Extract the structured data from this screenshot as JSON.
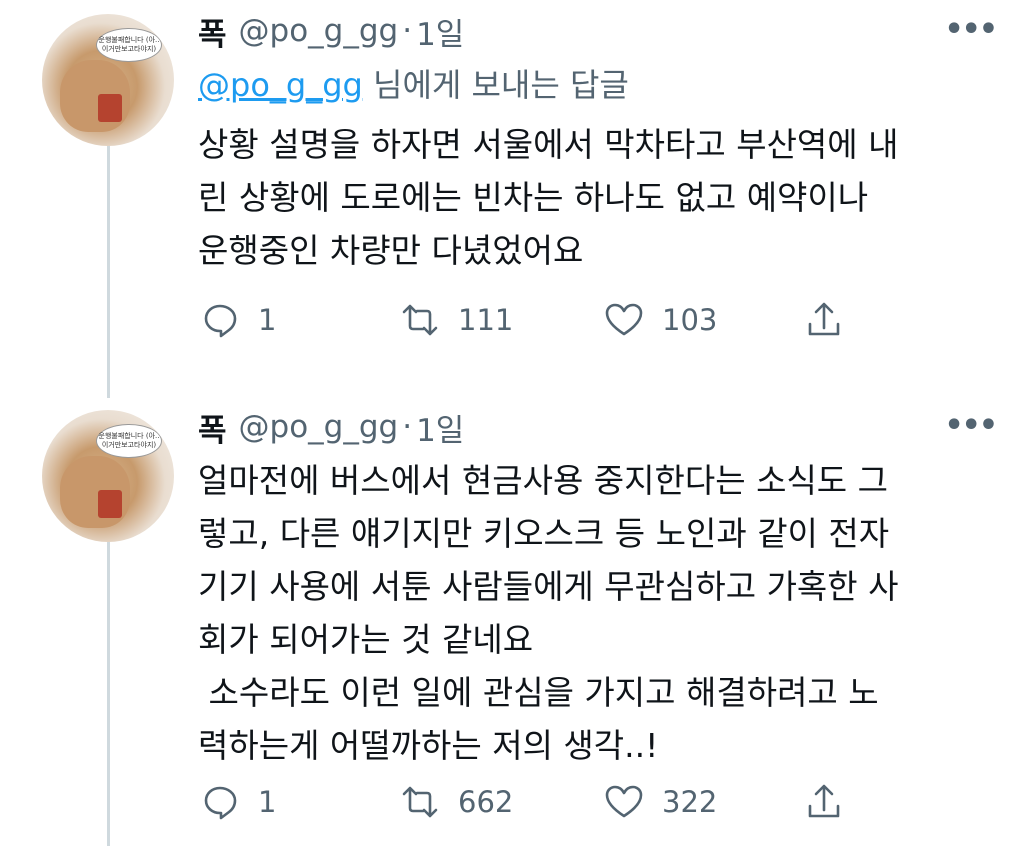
{
  "tweets": [
    {
      "name": "폭",
      "handle": "@po_g_gg",
      "dot": "·",
      "time": "1일",
      "more": "•••",
      "reply_link": "@po_g_gg",
      "reply_suffix": " 님에게 보내는 답글",
      "text": "상황 설명을 하자면 서울에서 막차타고 부산역에 내\n린 상황에 도로에는 빈차는 하나도 없고 예약이나\n운행중인 차량만 다녔었어요",
      "replies": "1",
      "retweets": "111",
      "likes": "103"
    },
    {
      "name": "폭",
      "handle": "@po_g_gg",
      "dot": "·",
      "time": "1일",
      "more": "•••",
      "text": "얼마전에 버스에서 현금사용 중지한다는 소식도 그\n렇고, 다른 얘기지만 키오스크 등 노인과 같이 전자\n기기 사용에 서툰 사람들에게 무관심하고 가혹한 사\n회가 되어가는 것 같네요\n 소수라도 이런 일에 관심을 가지고 해결하려고 노\n력하는게 어떨까하는 저의 생각..!",
      "replies": "1",
      "retweets": "662",
      "likes": "322"
    }
  ],
  "avatar": {
    "bubble_text": "운행불패합니다 (아..이거만보고타야지)"
  },
  "icons": [
    "reply-icon",
    "retweet-icon",
    "like-icon",
    "share-icon",
    "more-icon"
  ],
  "colors": {
    "link": "#1d9bf0",
    "muted": "#536471",
    "text": "#0f1419",
    "thread_line": "#cfd9de"
  }
}
